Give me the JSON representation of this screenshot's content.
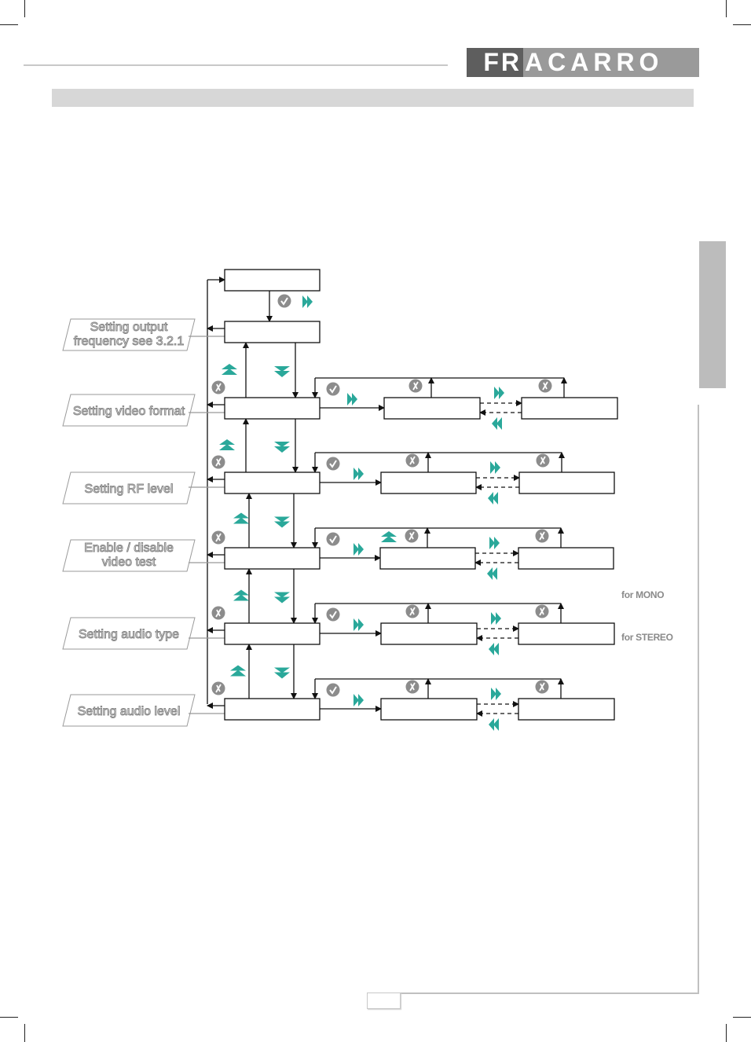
{
  "brand": {
    "logo_part_dark": "FR",
    "logo_part_light": "ACARRO",
    "colors": {
      "logo_dark": "#5e5e5e",
      "logo_light": "#9a9a9a",
      "teal_arrow": "#2aa89a",
      "icon_gray": "#8c8c8c"
    }
  },
  "page": {
    "page_number": ""
  },
  "diagram": {
    "menu_labels": [
      {
        "id": "output-frequency",
        "lines": [
          "Setting  output",
          "frequency see 3.2.1"
        ]
      },
      {
        "id": "video-format",
        "lines": [
          "Setting video format"
        ]
      },
      {
        "id": "rf-level",
        "lines": [
          "Setting  RF level"
        ]
      },
      {
        "id": "video-test",
        "lines": [
          "Enable / disable",
          "video test"
        ]
      },
      {
        "id": "audio-type",
        "lines": [
          "Setting  audio type"
        ]
      },
      {
        "id": "audio-level",
        "lines": [
          "Setting  audio level"
        ]
      }
    ],
    "side_notes": {
      "mono": "for MONO",
      "stereo": "for STEREO"
    },
    "icons": {
      "confirm": "check-icon",
      "cancel": "cross-icon",
      "up": "up-arrow-icon",
      "down": "down-arrow-icon",
      "right": "fast-forward-icon",
      "left": "rewind-icon"
    }
  }
}
